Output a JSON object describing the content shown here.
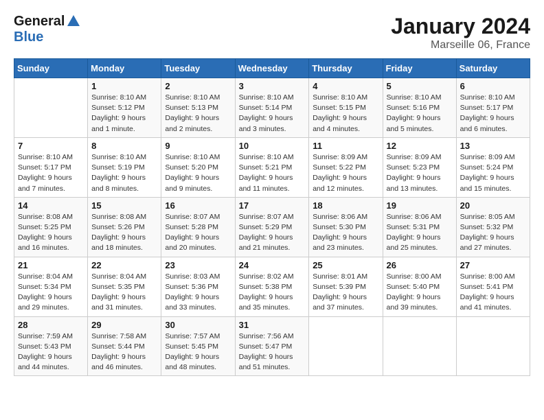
{
  "header": {
    "logo_general": "General",
    "logo_blue": "Blue",
    "title": "January 2024",
    "location": "Marseille 06, France"
  },
  "weekdays": [
    "Sunday",
    "Monday",
    "Tuesday",
    "Wednesday",
    "Thursday",
    "Friday",
    "Saturday"
  ],
  "weeks": [
    [
      {
        "day": "",
        "sunrise": "",
        "sunset": "",
        "daylight": ""
      },
      {
        "day": "1",
        "sunrise": "Sunrise: 8:10 AM",
        "sunset": "Sunset: 5:12 PM",
        "daylight": "Daylight: 9 hours and 1 minute."
      },
      {
        "day": "2",
        "sunrise": "Sunrise: 8:10 AM",
        "sunset": "Sunset: 5:13 PM",
        "daylight": "Daylight: 9 hours and 2 minutes."
      },
      {
        "day": "3",
        "sunrise": "Sunrise: 8:10 AM",
        "sunset": "Sunset: 5:14 PM",
        "daylight": "Daylight: 9 hours and 3 minutes."
      },
      {
        "day": "4",
        "sunrise": "Sunrise: 8:10 AM",
        "sunset": "Sunset: 5:15 PM",
        "daylight": "Daylight: 9 hours and 4 minutes."
      },
      {
        "day": "5",
        "sunrise": "Sunrise: 8:10 AM",
        "sunset": "Sunset: 5:16 PM",
        "daylight": "Daylight: 9 hours and 5 minutes."
      },
      {
        "day": "6",
        "sunrise": "Sunrise: 8:10 AM",
        "sunset": "Sunset: 5:17 PM",
        "daylight": "Daylight: 9 hours and 6 minutes."
      }
    ],
    [
      {
        "day": "7",
        "sunrise": "Sunrise: 8:10 AM",
        "sunset": "Sunset: 5:17 PM",
        "daylight": "Daylight: 9 hours and 7 minutes."
      },
      {
        "day": "8",
        "sunrise": "Sunrise: 8:10 AM",
        "sunset": "Sunset: 5:19 PM",
        "daylight": "Daylight: 9 hours and 8 minutes."
      },
      {
        "day": "9",
        "sunrise": "Sunrise: 8:10 AM",
        "sunset": "Sunset: 5:20 PM",
        "daylight": "Daylight: 9 hours and 9 minutes."
      },
      {
        "day": "10",
        "sunrise": "Sunrise: 8:10 AM",
        "sunset": "Sunset: 5:21 PM",
        "daylight": "Daylight: 9 hours and 11 minutes."
      },
      {
        "day": "11",
        "sunrise": "Sunrise: 8:09 AM",
        "sunset": "Sunset: 5:22 PM",
        "daylight": "Daylight: 9 hours and 12 minutes."
      },
      {
        "day": "12",
        "sunrise": "Sunrise: 8:09 AM",
        "sunset": "Sunset: 5:23 PM",
        "daylight": "Daylight: 9 hours and 13 minutes."
      },
      {
        "day": "13",
        "sunrise": "Sunrise: 8:09 AM",
        "sunset": "Sunset: 5:24 PM",
        "daylight": "Daylight: 9 hours and 15 minutes."
      }
    ],
    [
      {
        "day": "14",
        "sunrise": "Sunrise: 8:08 AM",
        "sunset": "Sunset: 5:25 PM",
        "daylight": "Daylight: 9 hours and 16 minutes."
      },
      {
        "day": "15",
        "sunrise": "Sunrise: 8:08 AM",
        "sunset": "Sunset: 5:26 PM",
        "daylight": "Daylight: 9 hours and 18 minutes."
      },
      {
        "day": "16",
        "sunrise": "Sunrise: 8:07 AM",
        "sunset": "Sunset: 5:28 PM",
        "daylight": "Daylight: 9 hours and 20 minutes."
      },
      {
        "day": "17",
        "sunrise": "Sunrise: 8:07 AM",
        "sunset": "Sunset: 5:29 PM",
        "daylight": "Daylight: 9 hours and 21 minutes."
      },
      {
        "day": "18",
        "sunrise": "Sunrise: 8:06 AM",
        "sunset": "Sunset: 5:30 PM",
        "daylight": "Daylight: 9 hours and 23 minutes."
      },
      {
        "day": "19",
        "sunrise": "Sunrise: 8:06 AM",
        "sunset": "Sunset: 5:31 PM",
        "daylight": "Daylight: 9 hours and 25 minutes."
      },
      {
        "day": "20",
        "sunrise": "Sunrise: 8:05 AM",
        "sunset": "Sunset: 5:32 PM",
        "daylight": "Daylight: 9 hours and 27 minutes."
      }
    ],
    [
      {
        "day": "21",
        "sunrise": "Sunrise: 8:04 AM",
        "sunset": "Sunset: 5:34 PM",
        "daylight": "Daylight: 9 hours and 29 minutes."
      },
      {
        "day": "22",
        "sunrise": "Sunrise: 8:04 AM",
        "sunset": "Sunset: 5:35 PM",
        "daylight": "Daylight: 9 hours and 31 minutes."
      },
      {
        "day": "23",
        "sunrise": "Sunrise: 8:03 AM",
        "sunset": "Sunset: 5:36 PM",
        "daylight": "Daylight: 9 hours and 33 minutes."
      },
      {
        "day": "24",
        "sunrise": "Sunrise: 8:02 AM",
        "sunset": "Sunset: 5:38 PM",
        "daylight": "Daylight: 9 hours and 35 minutes."
      },
      {
        "day": "25",
        "sunrise": "Sunrise: 8:01 AM",
        "sunset": "Sunset: 5:39 PM",
        "daylight": "Daylight: 9 hours and 37 minutes."
      },
      {
        "day": "26",
        "sunrise": "Sunrise: 8:00 AM",
        "sunset": "Sunset: 5:40 PM",
        "daylight": "Daylight: 9 hours and 39 minutes."
      },
      {
        "day": "27",
        "sunrise": "Sunrise: 8:00 AM",
        "sunset": "Sunset: 5:41 PM",
        "daylight": "Daylight: 9 hours and 41 minutes."
      }
    ],
    [
      {
        "day": "28",
        "sunrise": "Sunrise: 7:59 AM",
        "sunset": "Sunset: 5:43 PM",
        "daylight": "Daylight: 9 hours and 44 minutes."
      },
      {
        "day": "29",
        "sunrise": "Sunrise: 7:58 AM",
        "sunset": "Sunset: 5:44 PM",
        "daylight": "Daylight: 9 hours and 46 minutes."
      },
      {
        "day": "30",
        "sunrise": "Sunrise: 7:57 AM",
        "sunset": "Sunset: 5:45 PM",
        "daylight": "Daylight: 9 hours and 48 minutes."
      },
      {
        "day": "31",
        "sunrise": "Sunrise: 7:56 AM",
        "sunset": "Sunset: 5:47 PM",
        "daylight": "Daylight: 9 hours and 51 minutes."
      },
      {
        "day": "",
        "sunrise": "",
        "sunset": "",
        "daylight": ""
      },
      {
        "day": "",
        "sunrise": "",
        "sunset": "",
        "daylight": ""
      },
      {
        "day": "",
        "sunrise": "",
        "sunset": "",
        "daylight": ""
      }
    ]
  ]
}
